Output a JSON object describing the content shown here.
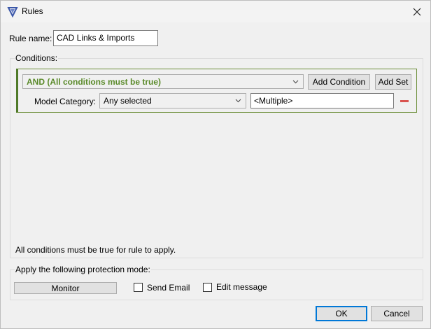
{
  "window": {
    "title": "Rules"
  },
  "icons": {
    "app": "shield-logo-icon",
    "close": "close-icon",
    "remove": "minus-icon",
    "chevron": "chevron-down-icon"
  },
  "rule": {
    "name_label": "Rule name:",
    "name_value": "CAD Links & Imports"
  },
  "conditions": {
    "group_title": "Conditions:",
    "set": {
      "logic": "AND (All conditions must be true)",
      "add_condition": "Add Condition",
      "add_set": "Add Set"
    },
    "rows": [
      {
        "label": "Model Category:",
        "operator": "Any selected",
        "value": "<Multiple>"
      }
    ],
    "footer_text": "All conditions must be true for rule to apply."
  },
  "protection": {
    "group_title": "Apply the following protection mode:",
    "mode_button": "Monitor",
    "send_email": {
      "label": "Send Email",
      "checked": false
    },
    "edit_message": {
      "label": "Edit message",
      "checked": false
    }
  },
  "dialog": {
    "ok": "OK",
    "cancel": "Cancel"
  },
  "colors": {
    "set_accent": "#4f7a28",
    "logic_text": "#5a8a2a",
    "remove": "#d9534f",
    "default_button": "#0078d7"
  }
}
